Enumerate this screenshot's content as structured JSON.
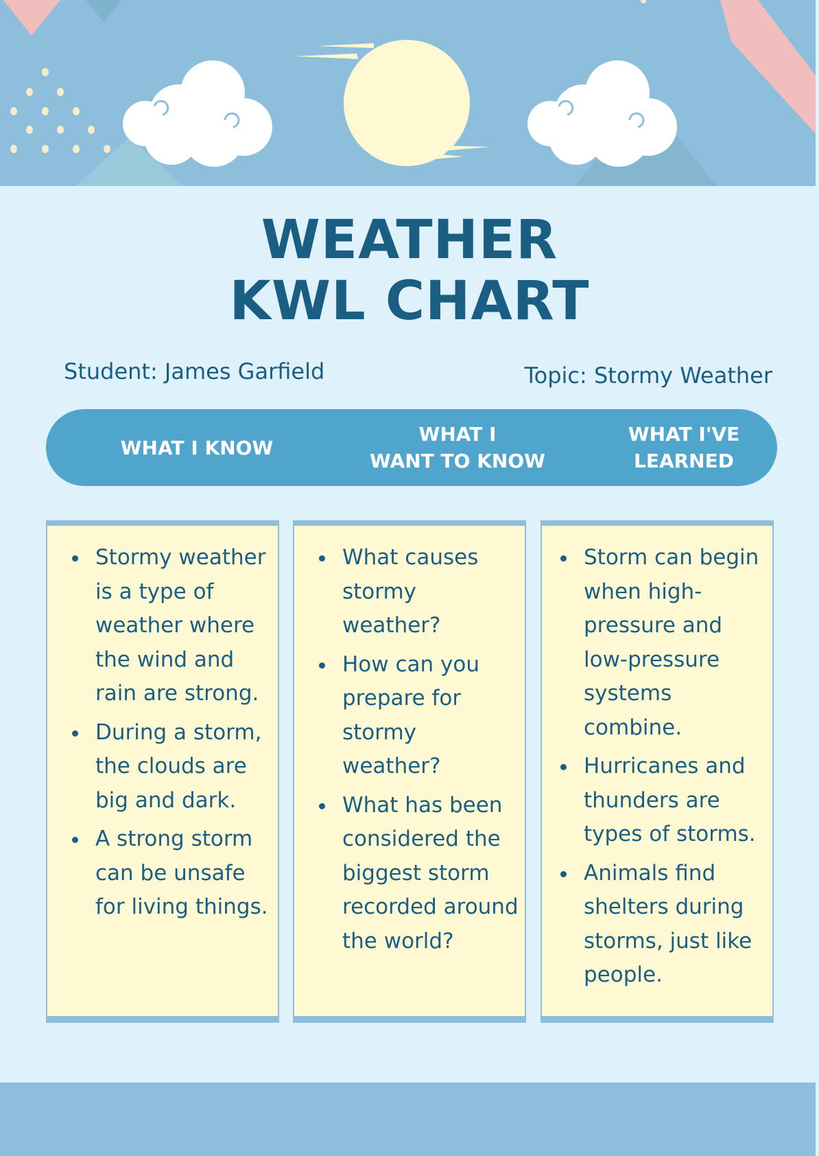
{
  "title": {
    "line1": "WEATHER",
    "line2": "KWL CHART"
  },
  "student": "Student: James Garfield",
  "topic": "Topic: Stormy Weather",
  "headers": {
    "know": "WHAT I KNOW",
    "want_line1": "WHAT I",
    "want_line2": "WANT TO KNOW",
    "learned_line1": "WHAT I'VE",
    "learned_line2": "LEARNED"
  },
  "columns": {
    "know": [
      "Stormy weather is a type of weather where the wind and rain are strong.",
      "During a storm, the clouds are big and dark.",
      "A strong storm can be unsafe for living things."
    ],
    "want": [
      "What causes stormy weather?",
      "How can you prepare for stormy weather?",
      "What has been considered the biggest storm recorded around the world?"
    ],
    "learned": [
      "Storm can begin when high-pressure and low-pressure systems combine.",
      "Hurricanes and thunders are types of storms.",
      "Animals find shelters during storms, just like people."
    ]
  },
  "colors": {
    "banner": "#8dbfdc",
    "background": "#dff2fc",
    "title": "#1b5e83",
    "pill": "#4fa5cc",
    "card": "#fef9d2",
    "sun": "#fef9d2",
    "pink": "#f2bdbd"
  }
}
